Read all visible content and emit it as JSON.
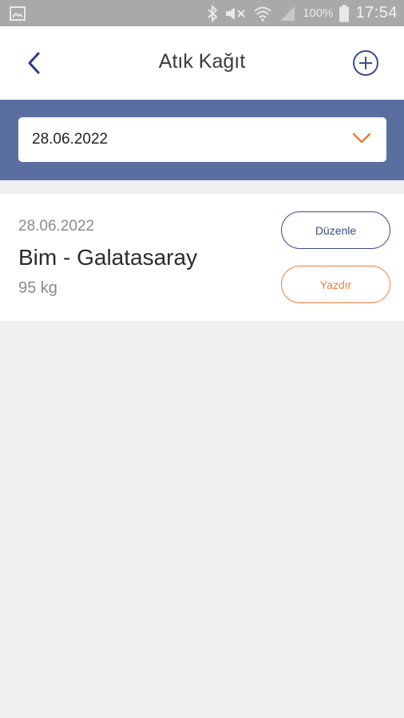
{
  "status_bar": {
    "battery_text": "100%",
    "time": "17:54",
    "icons": [
      "gallery-icon",
      "bluetooth-icon",
      "mute-icon",
      "wifi-icon",
      "signal-icon",
      "battery-icon"
    ]
  },
  "header": {
    "title": "Atık Kağıt",
    "back_icon": "chevron-left-icon",
    "add_icon": "plus-circle-icon"
  },
  "filter": {
    "date_value": "28.06.2022",
    "dropdown_icon": "chevron-down-icon"
  },
  "records": [
    {
      "date": "28.06.2022",
      "name": "Bim - Galatasaray",
      "weight": "95 kg",
      "edit_label": "Düzenle",
      "print_label": "Yazdır"
    }
  ],
  "colors": {
    "primary": "#3c4a8e",
    "accent": "#ee7d3e",
    "band": "#5a6fa0",
    "background": "#f0f0f0"
  }
}
